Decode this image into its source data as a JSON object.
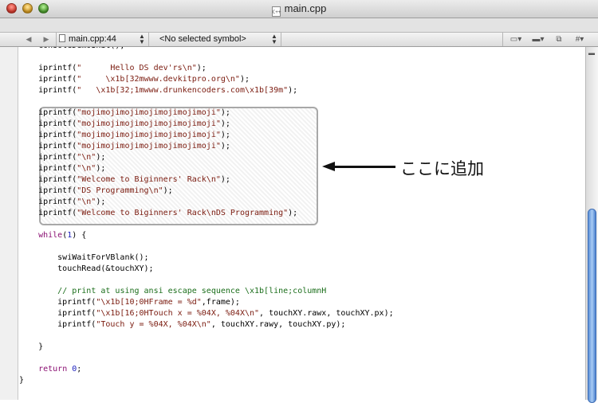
{
  "window": {
    "title": "main.cpp",
    "file_icon": "C++"
  },
  "navbar": {
    "back_glyph": "◀",
    "forward_glyph": "▶",
    "file_label": "main.cpp:44",
    "symbol_label": "<No selected symbol>",
    "updown_glyph": "▲\n▼",
    "tools": [
      "▭▾",
      "▬▾",
      "⧉",
      "#▾"
    ]
  },
  "code_lines": [
    {
      "t": [
        [
          "    consoleDemoInit();",
          ""
        ]
      ]
    },
    {
      "t": [
        [
          "",
          ""
        ]
      ]
    },
    {
      "t": [
        [
          "    iprintf(",
          ""
        ],
        [
          "\"      Hello DS dev'rs\\n\"",
          "str"
        ],
        [
          ");",
          ""
        ]
      ]
    },
    {
      "t": [
        [
          "    iprintf(",
          ""
        ],
        [
          "\"     \\x1b[32mwww.devkitpro.org\\n\"",
          "str"
        ],
        [
          ");",
          ""
        ]
      ]
    },
    {
      "t": [
        [
          "    iprintf(",
          ""
        ],
        [
          "\"   \\x1b[32;1mwww.drunkencoders.com\\x1b[39m\"",
          "str"
        ],
        [
          ");",
          ""
        ]
      ]
    },
    {
      "t": [
        [
          "",
          ""
        ]
      ]
    },
    {
      "t": [
        [
          "    iprintf(",
          ""
        ],
        [
          "\"mojimojimojimojimojimojimoji\"",
          "str"
        ],
        [
          ");",
          ""
        ]
      ]
    },
    {
      "t": [
        [
          "    iprintf(",
          ""
        ],
        [
          "\"mojimojimojimojimojimojimoji\"",
          "str"
        ],
        [
          ");",
          ""
        ]
      ]
    },
    {
      "t": [
        [
          "    iprintf(",
          ""
        ],
        [
          "\"mojimojimojimojimojimojimoji\"",
          "str"
        ],
        [
          ");",
          ""
        ]
      ]
    },
    {
      "t": [
        [
          "    iprintf(",
          ""
        ],
        [
          "\"mojimojimojimojimojimojimoji\"",
          "str"
        ],
        [
          ");",
          ""
        ]
      ]
    },
    {
      "t": [
        [
          "    iprintf(",
          ""
        ],
        [
          "\"\\n\"",
          "str"
        ],
        [
          ");",
          ""
        ]
      ]
    },
    {
      "t": [
        [
          "    iprintf(",
          ""
        ],
        [
          "\"\\n\"",
          "str"
        ],
        [
          ");",
          ""
        ]
      ]
    },
    {
      "t": [
        [
          "    iprintf(",
          ""
        ],
        [
          "\"Welcome to Biginners' Rack\\n\"",
          "str"
        ],
        [
          ");",
          ""
        ]
      ]
    },
    {
      "t": [
        [
          "    iprintf(",
          ""
        ],
        [
          "\"DS Programming\\n\"",
          "str"
        ],
        [
          ");",
          ""
        ]
      ]
    },
    {
      "t": [
        [
          "    iprintf(",
          ""
        ],
        [
          "\"\\n\"",
          "str"
        ],
        [
          ");",
          ""
        ]
      ]
    },
    {
      "t": [
        [
          "    iprintf(",
          ""
        ],
        [
          "\"Welcome to Biginners' Rack\\nDS Programming\"",
          "str"
        ],
        [
          ");",
          ""
        ]
      ]
    },
    {
      "t": [
        [
          "",
          ""
        ]
      ]
    },
    {
      "t": [
        [
          "    ",
          ""
        ],
        [
          "while",
          "kw"
        ],
        [
          "(",
          ""
        ],
        [
          "1",
          "num"
        ],
        [
          ") {",
          ""
        ]
      ]
    },
    {
      "t": [
        [
          "",
          ""
        ]
      ]
    },
    {
      "t": [
        [
          "        swiWaitForVBlank();",
          ""
        ]
      ]
    },
    {
      "t": [
        [
          "        touchRead(&touchXY);",
          ""
        ]
      ]
    },
    {
      "t": [
        [
          "",
          ""
        ]
      ]
    },
    {
      "t": [
        [
          "        ",
          ""
        ],
        [
          "// print at using ansi escape sequence \\x1b[line;columnH",
          "cmt"
        ]
      ]
    },
    {
      "t": [
        [
          "        iprintf(",
          ""
        ],
        [
          "\"\\x1b[10;0HFrame = %d\"",
          "str"
        ],
        [
          ",frame);",
          ""
        ]
      ]
    },
    {
      "t": [
        [
          "        iprintf(",
          ""
        ],
        [
          "\"\\x1b[16;0HTouch x = %04X, %04X\\n\"",
          "str"
        ],
        [
          ", touchXY.rawx, touchXY.px);",
          ""
        ]
      ]
    },
    {
      "t": [
        [
          "        iprintf(",
          ""
        ],
        [
          "\"Touch y = %04X, %04X\\n\"",
          "str"
        ],
        [
          ", touchXY.rawy, touchXY.py);",
          ""
        ]
      ]
    },
    {
      "t": [
        [
          "",
          ""
        ]
      ]
    },
    {
      "t": [
        [
          "    }",
          ""
        ]
      ]
    },
    {
      "t": [
        [
          "",
          ""
        ]
      ]
    },
    {
      "t": [
        [
          "    ",
          ""
        ],
        [
          "return",
          "kw"
        ],
        [
          " ",
          ""
        ],
        [
          "0",
          "num"
        ],
        [
          ";",
          ""
        ]
      ]
    },
    {
      "t": [
        [
          "}",
          ""
        ]
      ]
    }
  ],
  "annotation": {
    "text": "ここに追加"
  },
  "scrollbar": {
    "up": "▲",
    "down": "▼",
    "cap": "▬"
  },
  "colors": {
    "string": "#7a1a0e",
    "keyword": "#8a0f72",
    "number": "#1b1fbd",
    "comment": "#1b6e1b",
    "scroll_thumb": "#5b8fd6"
  }
}
